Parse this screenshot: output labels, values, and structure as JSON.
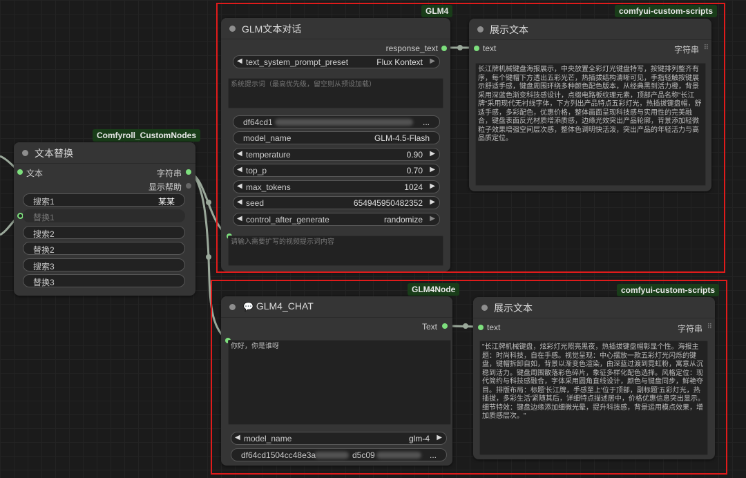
{
  "links_color": "#9aa89a",
  "node_glm4": {
    "group_badge": "GLM4",
    "title": "GLM文本对话",
    "output_label": "response_text",
    "preset": {
      "label": "text_system_prompt_preset",
      "value": "Flux Kontext"
    },
    "system_prompt_placeholder": "系统提示词（最高优先级，留空则从预设加载）",
    "api_key_visible": "df64cd1",
    "api_key_tail": "...",
    "model_name": {
      "label": "model_name",
      "value": "GLM-4.5-Flash"
    },
    "temperature": {
      "label": "temperature",
      "value": "0.90"
    },
    "top_p": {
      "label": "top_p",
      "value": "0.70"
    },
    "max_tokens": {
      "label": "max_tokens",
      "value": "1024"
    },
    "seed": {
      "label": "seed",
      "value": "654945950482352"
    },
    "control_after_generate": {
      "label": "control_after_generate",
      "value": "randomize"
    },
    "user_prompt_placeholder": "请输入需要扩写的视频提示词内容"
  },
  "node_show_text_1": {
    "group_badge": "comfyui-custom-scripts",
    "title": "展示文本",
    "input_label": "text",
    "output_label": "字符串",
    "content": "长江牌机械键盘海报展示，中央放置全彩灯光键盘特写，按键排列整齐有序，每个键帽下方透出五彩光芒，热插拔结构清晰可见，手指轻触按键展示舒适手感，键盘周围环绕多种颜色配色版本，从经典黑到活力橙，背景采用深蓝色渐变科技感设计，点缀电路板纹理元素，顶部产品名称\"长江牌\"采用现代无衬线字体，下方列出产品特点五彩灯光，热插拔键盘帽，舒适手感，多彩配色，优惠价格，整体画面呈现科技感与实用性的完美融合，键盘表面反光材质增添质感，边缘光效突出产品轮廓，背景添加轻微粒子效果增强空间层次感，整体色调明快活泼，突出产品的年轻活力与高品质定位。"
  },
  "node_text_replace": {
    "group_badge": "Comfyroll_CustomNodes",
    "title": "文本替换",
    "input_label": "文本",
    "outputs": [
      "字符串",
      "显示帮助"
    ],
    "widgets": [
      {
        "label": "搜索1",
        "value": "某某"
      },
      {
        "label": "替换1",
        "value": ""
      },
      {
        "label": "搜索2",
        "value": ""
      },
      {
        "label": "替换2",
        "value": ""
      },
      {
        "label": "搜索3",
        "value": ""
      },
      {
        "label": "替换3",
        "value": ""
      }
    ]
  },
  "node_glm4_chat": {
    "group_badge": "GLM4Node",
    "title": "GLM4_CHAT",
    "title_icon": "speech-bubble-icon",
    "output_label": "Text",
    "prompt": "你好，你是谁呀",
    "model_name": {
      "label": "model_name",
      "value": "glm-4"
    },
    "api_key_visible": "df64cd1504cc48e3a",
    "api_key_mid": "d5c09",
    "api_key_tail": "..."
  },
  "node_show_text_2": {
    "group_badge": "comfyui-custom-scripts",
    "title": "展示文本",
    "input_label": "text",
    "output_label": "字符串",
    "content": "\"长江牌机械键盘，炫彩灯光照亮黑夜，热插拔键盘帽彰显个性。海报主题：时尚科技，自在手感。视觉呈现：中心摆放一款五彩灯光闪烁的键盘，键帽拆卸自如，背景以渐变色渲染，由深蓝过渡到霓虹粉，寓意从沉稳到活力。键盘周围散落彩色碎片，象征多样化配色选择。风格定位：现代简约与科技感融合，字体采用圆角直线设计，颜色与键盘同步，鲜艳夺目。排版布局：标题'长江牌，手感至上'位于顶部，副标题'五彩灯光，热插拔，多彩生活'紧随其后，详细特点描述居中，价格优惠信息突出显示。细节特效：键盘边缘添加细微光晕，提升科技感，背景运用模点效果，增加质感层次。\""
  },
  "icons": {
    "arrow_left": "◀",
    "arrow_right": "▶",
    "grip": "grip-icon",
    "speech": "speech-bubble-icon"
  }
}
